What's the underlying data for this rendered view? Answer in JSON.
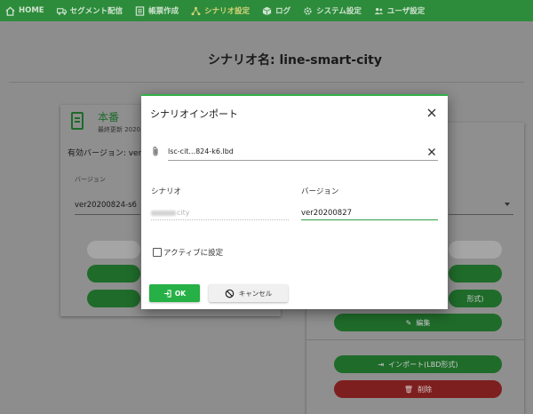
{
  "nav": {
    "items": [
      {
        "label": "HOME",
        "icon": "home-icon"
      },
      {
        "label": "セグメント配信",
        "icon": "segment-delivery-icon"
      },
      {
        "label": "帳票作成",
        "icon": "report-icon"
      },
      {
        "label": "シナリオ設定",
        "icon": "scenario-icon"
      },
      {
        "label": "ログ",
        "icon": "log-icon"
      },
      {
        "label": "システム設定",
        "icon": "gear-icon"
      },
      {
        "label": "ユーザ設定",
        "icon": "users-icon"
      }
    ],
    "active_index": 3,
    "bg_color": "#2d8c3b",
    "active_color": "#d9d37a"
  },
  "page": {
    "scenario_title": "シナリオ名: line-smart-city",
    "production": {
      "label": "本番",
      "updated": "最終更新 2020",
      "active_version": "有効バージョン: ver",
      "version_label": "バージョン",
      "version_value": "ver20200824-s6"
    },
    "right_buttons": {
      "import_lbd": "インポート(LBD形式)",
      "delete": "削除",
      "edit": "編集",
      "format_partial": "形式)"
    }
  },
  "modal": {
    "title": "シナリオインポート",
    "file_name": "lsc-cit...824-k6.lbd",
    "scenario_label": "シナリオ",
    "scenario_value": "city",
    "version_label": "バージョン",
    "version_value": "ver20200827",
    "active_checkbox_label": "アクティブに設定",
    "active_checked": false,
    "ok_label": "OK",
    "cancel_label": "キャンセル",
    "accent_color": "#31b04a"
  }
}
